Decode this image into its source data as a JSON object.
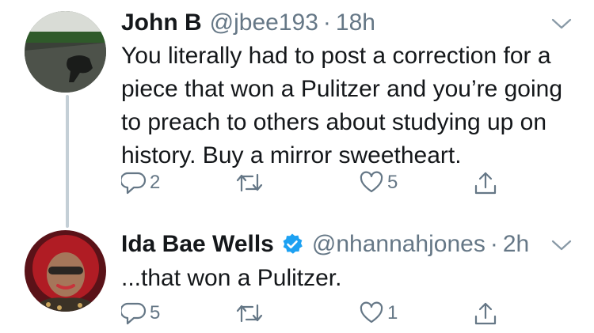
{
  "tweets": [
    {
      "author_name": "John B",
      "handle": "@jbee193",
      "separator": "·",
      "time": "18h",
      "verified": false,
      "text": "You literally had to post a correction for a piece that won a Pulitzer and you’re going to preach to others about studying up on history. Buy a mirror sweetheart.",
      "reply_count": "2",
      "retweet_count": "",
      "like_count": "5",
      "icons": [
        "reply-icon",
        "retweet-icon",
        "like-icon",
        "share-icon",
        "chevron-down-icon"
      ]
    },
    {
      "author_name": "Ida Bae Wells",
      "handle": "@nhannahjones",
      "separator": "·",
      "time": "2h",
      "verified": true,
      "text": "...that won a Pulitzer.",
      "reply_count": "5",
      "retweet_count": "",
      "like_count": "1",
      "icons": [
        "reply-icon",
        "retweet-icon",
        "like-icon",
        "share-icon",
        "chevron-down-icon",
        "verified-badge-icon"
      ]
    }
  ],
  "colors": {
    "text": "#14171a",
    "secondary": "#657786",
    "thread_line": "#c4cfd6",
    "verified": "#1da1f2",
    "background": "#ffffff"
  }
}
